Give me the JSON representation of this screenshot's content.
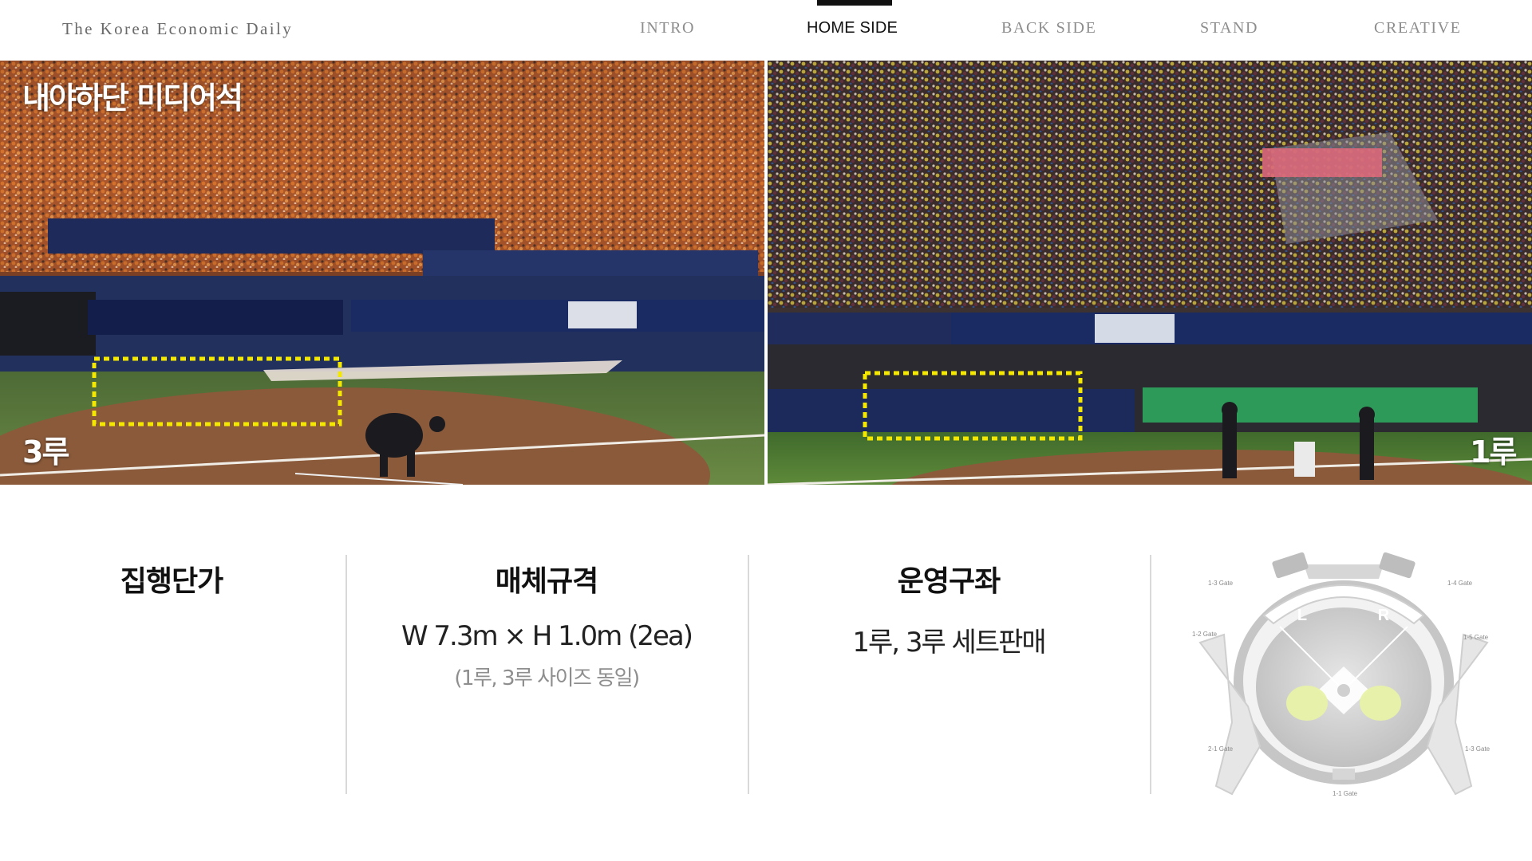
{
  "header": {
    "brand": "The Korea Economic Daily",
    "nav": [
      {
        "label": "INTRO",
        "active": false
      },
      {
        "label": "HOME SIDE",
        "active": true
      },
      {
        "label": "BACK SIDE",
        "active": false
      },
      {
        "label": "STAND",
        "active": false
      },
      {
        "label": "CREATIVE",
        "active": false
      }
    ]
  },
  "photos": {
    "title": "내야하단 미디어석",
    "left_label": "3루",
    "right_label": "1루",
    "highlight_color": "#f4e800"
  },
  "info": {
    "price": {
      "title": "집행단가"
    },
    "spec": {
      "title": "매체규격",
      "value": "W 7.3m × H 1.0m (2ea)",
      "note": "(1루, 3루 사이즈 동일)"
    },
    "operation": {
      "title": "운영구좌",
      "value": "1루, 3루 세트판매"
    }
  },
  "map": {
    "gates": [
      "1-3 Gate",
      "1-4 Gate",
      "1-2 Gate",
      "1-5 Gate",
      "2-1 Gate",
      "1-1 Gate",
      "1-3 Gate"
    ],
    "left_letter": "L",
    "right_letter": "R",
    "highlight_color": "#e8f2a8"
  }
}
